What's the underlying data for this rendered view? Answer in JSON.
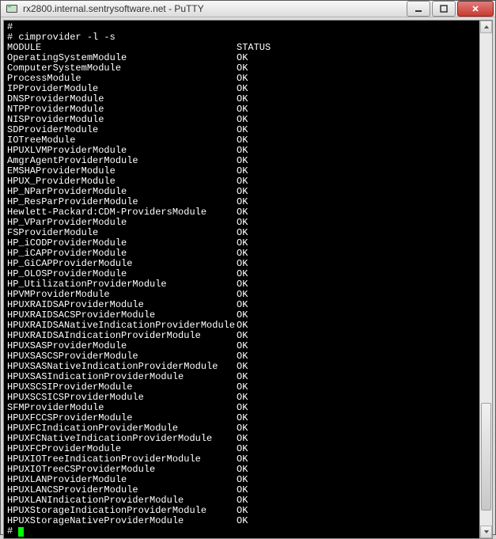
{
  "window": {
    "title": "rx2800.internal.sentrysoftware.net - PuTTY"
  },
  "terminal": {
    "prompt": "#",
    "command": "cimprovider -l -s",
    "header_module": "MODULE",
    "header_status": "STATUS",
    "rows": [
      {
        "module": "OperatingSystemModule",
        "status": "OK"
      },
      {
        "module": "ComputerSystemModule",
        "status": "OK"
      },
      {
        "module": "ProcessModule",
        "status": "OK"
      },
      {
        "module": "IPProviderModule",
        "status": "OK"
      },
      {
        "module": "DNSProviderModule",
        "status": "OK"
      },
      {
        "module": "NTPProviderModule",
        "status": "OK"
      },
      {
        "module": "NISProviderModule",
        "status": "OK"
      },
      {
        "module": "SDProviderModule",
        "status": "OK"
      },
      {
        "module": "IOTreeModule",
        "status": "OK"
      },
      {
        "module": "HPUXLVMProviderModule",
        "status": "OK"
      },
      {
        "module": "AmgrAgentProviderModule",
        "status": "OK"
      },
      {
        "module": "EMSHAProviderModule",
        "status": "OK"
      },
      {
        "module": "HPUX_ProviderModule",
        "status": "OK"
      },
      {
        "module": "HP_NParProviderModule",
        "status": "OK"
      },
      {
        "module": "HP_ResParProviderModule",
        "status": "OK"
      },
      {
        "module": "Hewlett-Packard:CDM-ProvidersModule",
        "status": "OK"
      },
      {
        "module": "HP_VParProviderModule",
        "status": "OK"
      },
      {
        "module": "FSProviderModule",
        "status": "OK"
      },
      {
        "module": "HP_iCODProviderModule",
        "status": "OK"
      },
      {
        "module": "HP_iCAPProviderModule",
        "status": "OK"
      },
      {
        "module": "HP_GiCAPProviderModule",
        "status": "OK"
      },
      {
        "module": "HP_OLOSProviderModule",
        "status": "OK"
      },
      {
        "module": "HP_UtilizationProviderModule",
        "status": "OK"
      },
      {
        "module": "HPVMProviderModule",
        "status": "OK"
      },
      {
        "module": "HPUXRAIDSAProviderModule",
        "status": "OK"
      },
      {
        "module": "HPUXRAIDSACSProviderModule",
        "status": "OK"
      },
      {
        "module": "HPUXRAIDSANativeIndicationProviderModule",
        "status": "OK"
      },
      {
        "module": "HPUXRAIDSAIndicationProviderModule",
        "status": "OK"
      },
      {
        "module": "HPUXSASProviderModule",
        "status": "OK"
      },
      {
        "module": "HPUXSASCSProviderModule",
        "status": "OK"
      },
      {
        "module": "HPUXSASNativeIndicationProviderModule",
        "status": "OK"
      },
      {
        "module": "HPUXSASIndicationProviderModule",
        "status": "OK"
      },
      {
        "module": "HPUXSCSIProviderModule",
        "status": "OK"
      },
      {
        "module": "HPUXSCSICSProviderModule",
        "status": "OK"
      },
      {
        "module": "SFMProviderModule",
        "status": "OK"
      },
      {
        "module": "HPUXFCCSProviderModule",
        "status": "OK"
      },
      {
        "module": "HPUXFCIndicationProviderModule",
        "status": "OK"
      },
      {
        "module": "HPUXFCNativeIndicationProviderModule",
        "status": "OK"
      },
      {
        "module": "HPUXFCProviderModule",
        "status": "OK"
      },
      {
        "module": "HPUXIOTreeIndicationProviderModule",
        "status": "OK"
      },
      {
        "module": "HPUXIOTreeCSProviderModule",
        "status": "OK"
      },
      {
        "module": "HPUXLANProviderModule",
        "status": "OK"
      },
      {
        "module": "HPUXLANCSProviderModule",
        "status": "OK"
      },
      {
        "module": "HPUXLANIndicationProviderModule",
        "status": "OK"
      },
      {
        "module": "HPUXStorageIndicationProviderModule",
        "status": "OK"
      },
      {
        "module": "HPUXStorageNativeProviderModule",
        "status": "OK"
      }
    ]
  }
}
